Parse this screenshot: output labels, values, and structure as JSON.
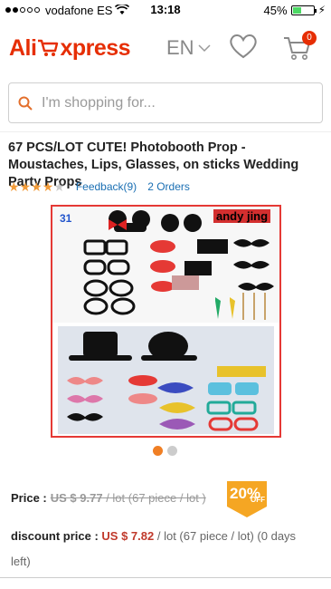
{
  "status": {
    "carrier": "vodafone ES",
    "time": "13:18",
    "battery": "45%",
    "battery_level": 0.45
  },
  "header": {
    "logo_left": "Ali",
    "logo_right": "xpress",
    "lang": "EN",
    "cart_count": "0"
  },
  "search": {
    "placeholder": "I'm shopping for..."
  },
  "product": {
    "title": "67 PCS/LOT CUTE! Photobooth Prop - Moustaches, Lips, Glasses, on sticks Wedding Party Props",
    "rating": 4.5,
    "feedback": "Feedback(9)",
    "orders": "2 Orders",
    "image_watermark": "andy jing",
    "image_number": "31",
    "image_pages": 2,
    "image_page_current": 1
  },
  "pricing": {
    "price_label": "Price :",
    "old_price": "US $ 9.77",
    "old_unit": " / lot (67 piece / lot )",
    "discount_pct": "20%",
    "discount_off": "OFF",
    "discount_label": "discount price :",
    "new_price": "US $ 7.82",
    "new_unit": " / lot (67 piece / lot)",
    "days_left": " (0 days left)"
  }
}
